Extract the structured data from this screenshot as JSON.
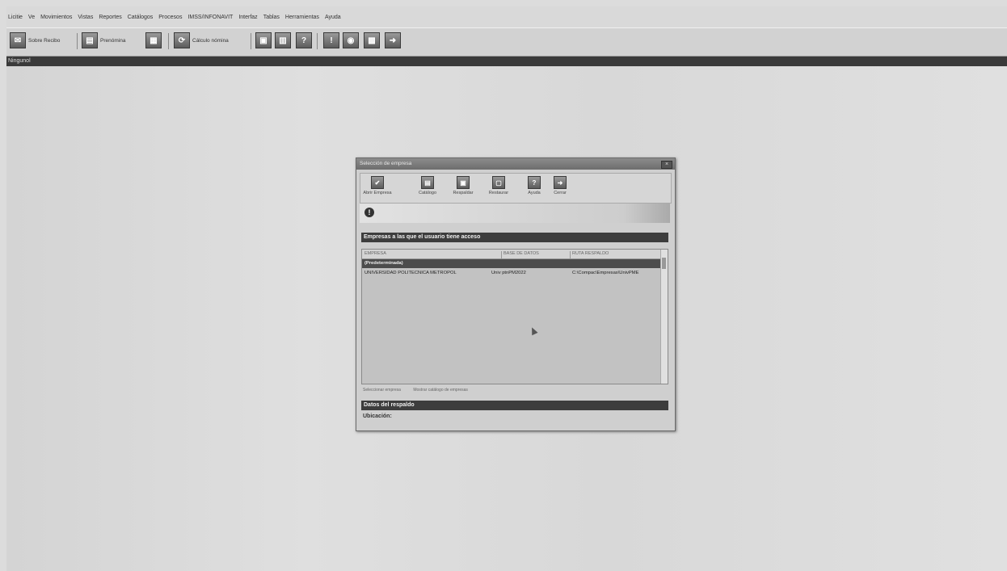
{
  "menubar": {
    "items": [
      "Licitie",
      "Ve",
      "Movimientos",
      "Vistas",
      "Reportes",
      "Catálogos",
      "Procesos",
      "IMSS/INFONAVIT",
      "Interfaz",
      "Tablas",
      "Herramientas",
      "Ayuda"
    ]
  },
  "toolbar": {
    "sobre_recibo": "Sobre Recibo",
    "prenomina": "Prenómina",
    "calculo_nomina": "Cálculo nómina"
  },
  "statusbar": {
    "text": "Ningunol"
  },
  "dialog": {
    "title": "Selección de empresa",
    "close_label": "×",
    "toolbar": {
      "abrir_empresa": "Abrir Empresa",
      "catalogo": "Catálogo",
      "respaldar": "Respaldar",
      "restaurar": "Restaurar",
      "ayuda": "Ayuda",
      "cerrar": "Cerrar"
    },
    "section_empresas": "Empresas a las que el usuario tiene acceso",
    "table": {
      "columns": [
        "EMPRESA",
        "BASE DE DATOS",
        "RUTA RESPALDO"
      ],
      "rows": [
        {
          "empresa": "(Predeterminada)",
          "base": "",
          "ruta": ""
        },
        {
          "empresa": "UNIVERSIDAD POLITECNICA METROPOL",
          "base": "Univ ptnPM2022",
          "ruta": "C:\\Compac\\Empresas\\UnivPME"
        }
      ]
    },
    "links": [
      "Seleccionar empresa",
      "Mostrar catálogo de empresas"
    ],
    "section_respaldo": "Datos del respaldo",
    "ubicacion_label": "Ubicación:"
  }
}
